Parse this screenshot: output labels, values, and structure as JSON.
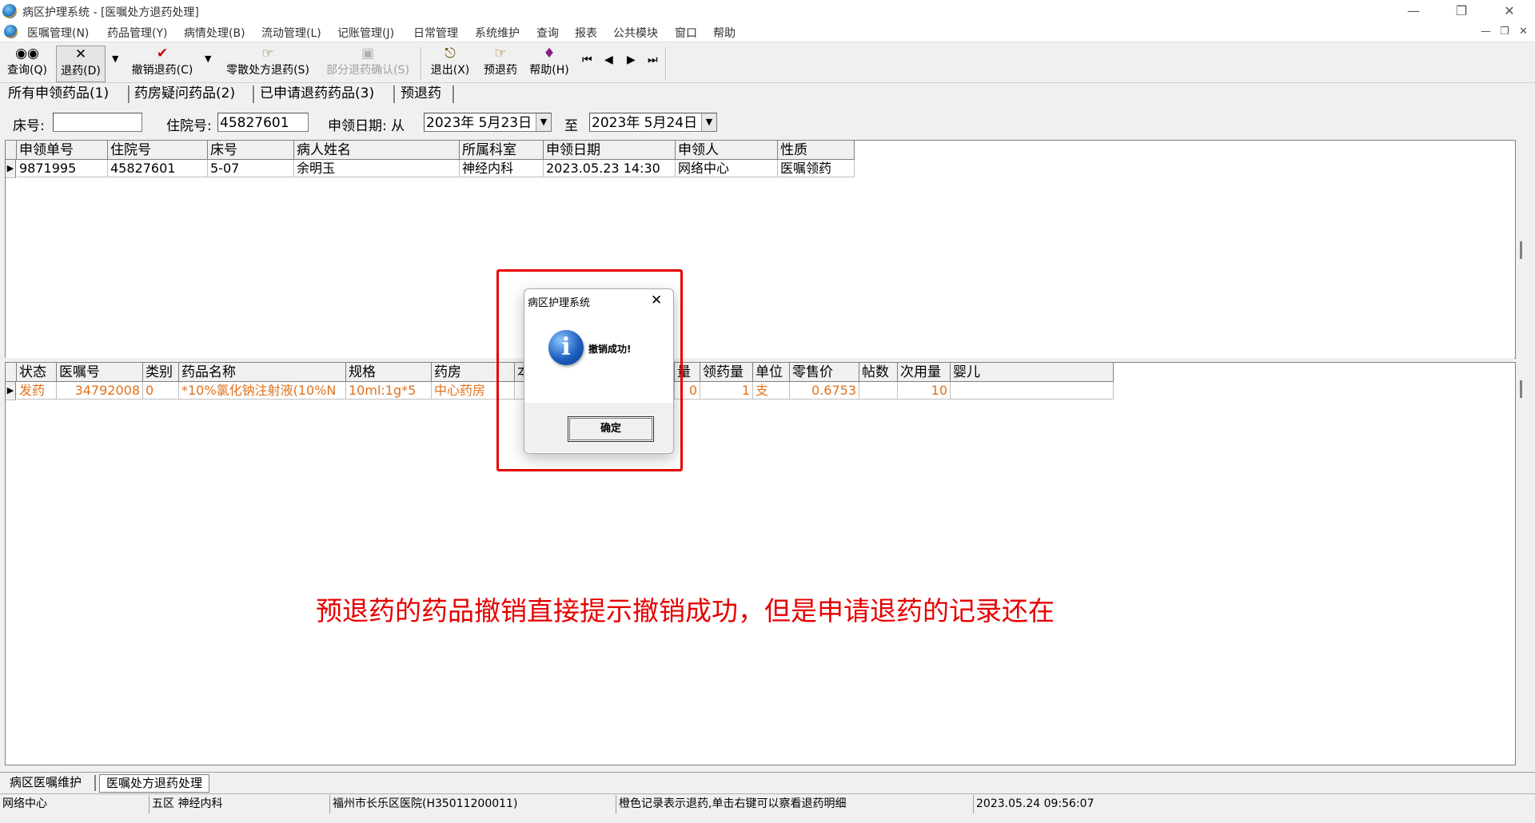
{
  "window": {
    "title": "病区护理系统 - [医嘱处方退药处理]"
  },
  "menu": [
    "医嘱管理(N)",
    "药品管理(Y)",
    "病情处理(B)",
    "流动管理(L)",
    "记账管理(J)",
    "日常管理",
    "系统维护",
    "查询",
    "报表",
    "公共模块",
    "窗口",
    "帮助"
  ],
  "toolbar": {
    "query": "查询(Q)",
    "return": "退药(D)",
    "cancel_return": "撤销退药(C)",
    "loose_return": "零散处方退药(S)",
    "partial_confirm": "部分退药确认(S)",
    "exit": "退出(X)",
    "pre_return": "预退药",
    "help": "帮助(H)"
  },
  "tabs": [
    "所有申领药品(1)",
    "药房疑问药品(2)",
    "已申请退药药品(3)",
    "预退药"
  ],
  "filter": {
    "bed_label": "床号:",
    "bed_value": "",
    "inpatient_label": "住院号:",
    "inpatient_value": "45827601",
    "date_label": "申领日期: 从",
    "date_from": "2023年 5月23日",
    "to_label": "至",
    "date_to": "2023年 5月24日"
  },
  "upper_grid": {
    "headers": [
      "申领单号",
      "住院号",
      "床号",
      "病人姓名",
      "所属科室",
      "申领日期",
      "申领人",
      "性质"
    ],
    "rows": [
      [
        "9871995",
        "45827601",
        "5-07",
        "余明玉",
        "神经内科",
        "2023.05.23 14:30",
        "网络中心",
        "医嘱领药"
      ]
    ]
  },
  "lower_grid": {
    "headers": [
      "状态",
      "医嘱号",
      "类别",
      "药品名称",
      "规格",
      "药房",
      "本",
      "量",
      "领药量",
      "单位",
      "零售价",
      "帖数",
      "次用量",
      "婴儿"
    ],
    "rows": [
      [
        "发药",
        "34792008",
        "0",
        "*10%氯化钠注射液(10%N",
        "10ml:1g*5",
        "中心药房",
        "",
        "0",
        "1",
        "支",
        "0.6753",
        "",
        "10",
        ""
      ]
    ]
  },
  "dialog": {
    "title": "病区护理系统",
    "message": "撤销成功!",
    "ok": "确定"
  },
  "annotation": "预退药的药品撤销直接提示撤销成功，但是申请退药的记录还在",
  "bottom_tabs": [
    "病区医嘱维护",
    "医嘱处方退药处理"
  ],
  "status": {
    "user": "网络中心",
    "ward": "五区 神经内科",
    "hospital": "福州市长乐区医院(H35011200011)",
    "hint": "橙色记录表示退药,单击右键可以察看退药明细",
    "datetime": "2023.05.24 09:56:07"
  },
  "colors": {
    "returned_row": "#e2721d",
    "annotation": "#e60000"
  }
}
